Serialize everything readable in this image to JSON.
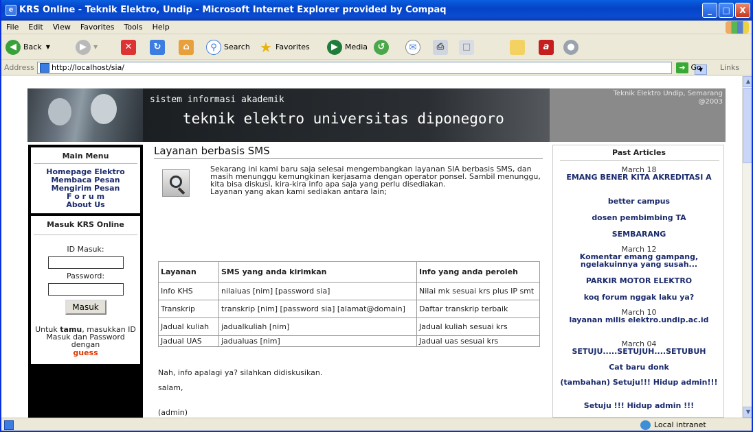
{
  "window": {
    "title": "KRS Online - Teknik Elektro, Undip - Microsoft Internet Explorer provided by Compaq",
    "min_glyph": "_",
    "max_glyph": "□",
    "close_glyph": "X"
  },
  "menu": [
    "File",
    "Edit",
    "View",
    "Favorites",
    "Tools",
    "Help"
  ],
  "toolbar": {
    "back": "Back",
    "search": "Search",
    "favorites": "Favorites",
    "media": "Media"
  },
  "address": {
    "label": "Address",
    "url": "http://localhost/sia/",
    "go": "Go",
    "links": "Links"
  },
  "status": {
    "zone": "Local intranet"
  },
  "banner": {
    "subtitle": "sistem informasi akademik",
    "title": "teknik elektro universitas diponegoro",
    "right_line1": "Teknik Elektro Undip, Semarang",
    "right_line2": "@2003"
  },
  "left": {
    "main_menu_title": "Main Menu",
    "links": [
      "Homepage Elektro",
      "Membaca Pesan",
      "Mengirim Pesan",
      "F o r u m",
      "About Us"
    ],
    "login_title": "Masuk KRS Online",
    "id_label": "ID Masuk:",
    "pw_label": "Password:",
    "submit": "Masuk",
    "note_pre": "Untuk ",
    "note_bold": "tamu",
    "note_post": ", masukkan ID Masuk dan Password dengan",
    "guest": "guess"
  },
  "content": {
    "title": "Layanan berbasis SMS",
    "intro_1": "Sekarang ini kami baru saja selesai mengembangkan layanan SIA berbasis SMS, dan masih menunggu kemungkinan kerjasama dengan operator ponsel. Sambil menunggu, kita bisa diskusi, kira-kira info apa saja yang perlu disediakan.",
    "intro_2": "Layanan yang akan kami sediakan antara lain;",
    "table_headers": [
      "Layanan",
      "SMS yang anda kirimkan",
      "Info yang anda peroleh"
    ],
    "rows": [
      [
        "Info KHS",
        "nilaiuas [nim] [password sia]",
        "Nilai mk sesuai krs plus IP smt"
      ],
      [
        "Transkrip",
        "transkrip [nim] [password sia] [alamat@domain]",
        "Daftar transkrip terbaik"
      ],
      [
        "Jadual kuliah",
        "jadualkuliah [nim]",
        "Jadual kuliah sesuai krs"
      ],
      [
        "Jadual UAS",
        "jadualuas [nim]",
        "Jadual uas sesuai krs"
      ]
    ],
    "closing": "Nah, info apalagi ya? silahkan didiskusikan.",
    "salam": "salam,",
    "signature": "(admin)"
  },
  "articles": {
    "title": "Past Articles",
    "items": [
      {
        "date": "March 18",
        "title": "EMANG BENER KITA AKREDITASI A"
      },
      {
        "date": "",
        "title": "better campus"
      },
      {
        "date": "",
        "title": "dosen pembimbing TA"
      },
      {
        "date": "",
        "title": "SEMBARANG"
      },
      {
        "date": "March 12",
        "title": "Komentar emang gampang, ngelakuinnya yang susah..."
      },
      {
        "date": "",
        "title": "PARKIR MOTOR ELEKTRO"
      },
      {
        "date": "",
        "title": "koq forum nggak laku ya?"
      },
      {
        "date": "March 10",
        "title": "layanan milis elektro.undip.ac.id"
      },
      {
        "date": "March 04",
        "title": "SETUJU.....SETUJUH....SETUBUH"
      },
      {
        "date": "",
        "title": "Cat baru donk"
      },
      {
        "date": "",
        "title": "(tambahan) Setuju!!! Hidup admin!!!"
      },
      {
        "date": "",
        "title": "Setuju !!! Hidup admin !!!"
      }
    ]
  }
}
